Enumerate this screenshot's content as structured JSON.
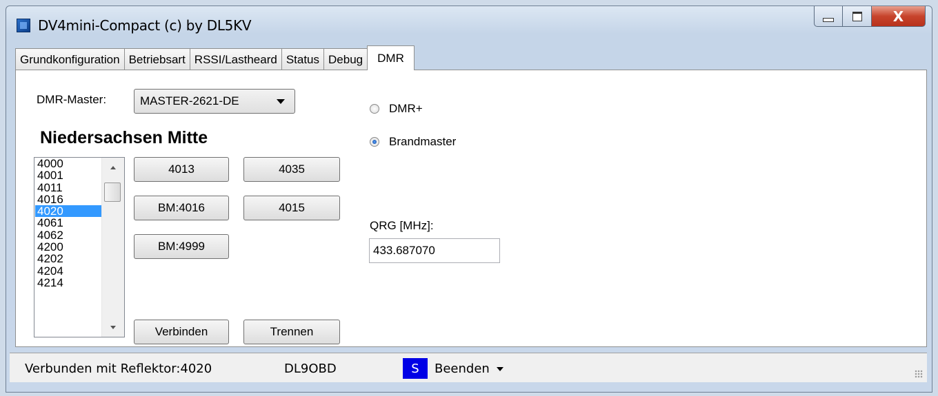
{
  "window": {
    "title": "DV4mini-Compact (c) by DL5KV"
  },
  "caption_buttons": {
    "close_glyph": "X"
  },
  "tabs": [
    {
      "label": "Grundkonfiguration"
    },
    {
      "label": "Betriebsart"
    },
    {
      "label": "RSSI/Lastheard"
    },
    {
      "label": "Status"
    },
    {
      "label": "Debug"
    },
    {
      "label": "DMR",
      "active": true
    }
  ],
  "dmr": {
    "master_label": "DMR-Master:",
    "master_selected": "MASTER-2621-DE",
    "region_heading": "Niedersachsen Mitte",
    "reflector_list": [
      "4000",
      "4001",
      "4011",
      "4016",
      "4020",
      "4061",
      "4062",
      "4200",
      "4202",
      "4204",
      "4214"
    ],
    "selected_reflector": "4020",
    "quick_buttons": [
      "4013",
      "4035",
      "BM:4016",
      "4015",
      "BM:4999"
    ],
    "connect_label": "Verbinden",
    "disconnect_label": "Trennen",
    "radio_options": [
      {
        "label": "DMR+",
        "checked": false
      },
      {
        "label": "Brandmaster",
        "checked": true
      }
    ],
    "qrg_label": "QRG [MHz]:",
    "qrg_value": "433.687070"
  },
  "status": {
    "connection_text": "Verbunden mit Reflektor:4020",
    "callsign": "DL9OBD",
    "indicator": "S",
    "exit_label": "Beenden"
  },
  "colors": {
    "selection": "#3399ff",
    "status_indicator": "#0000e6"
  }
}
